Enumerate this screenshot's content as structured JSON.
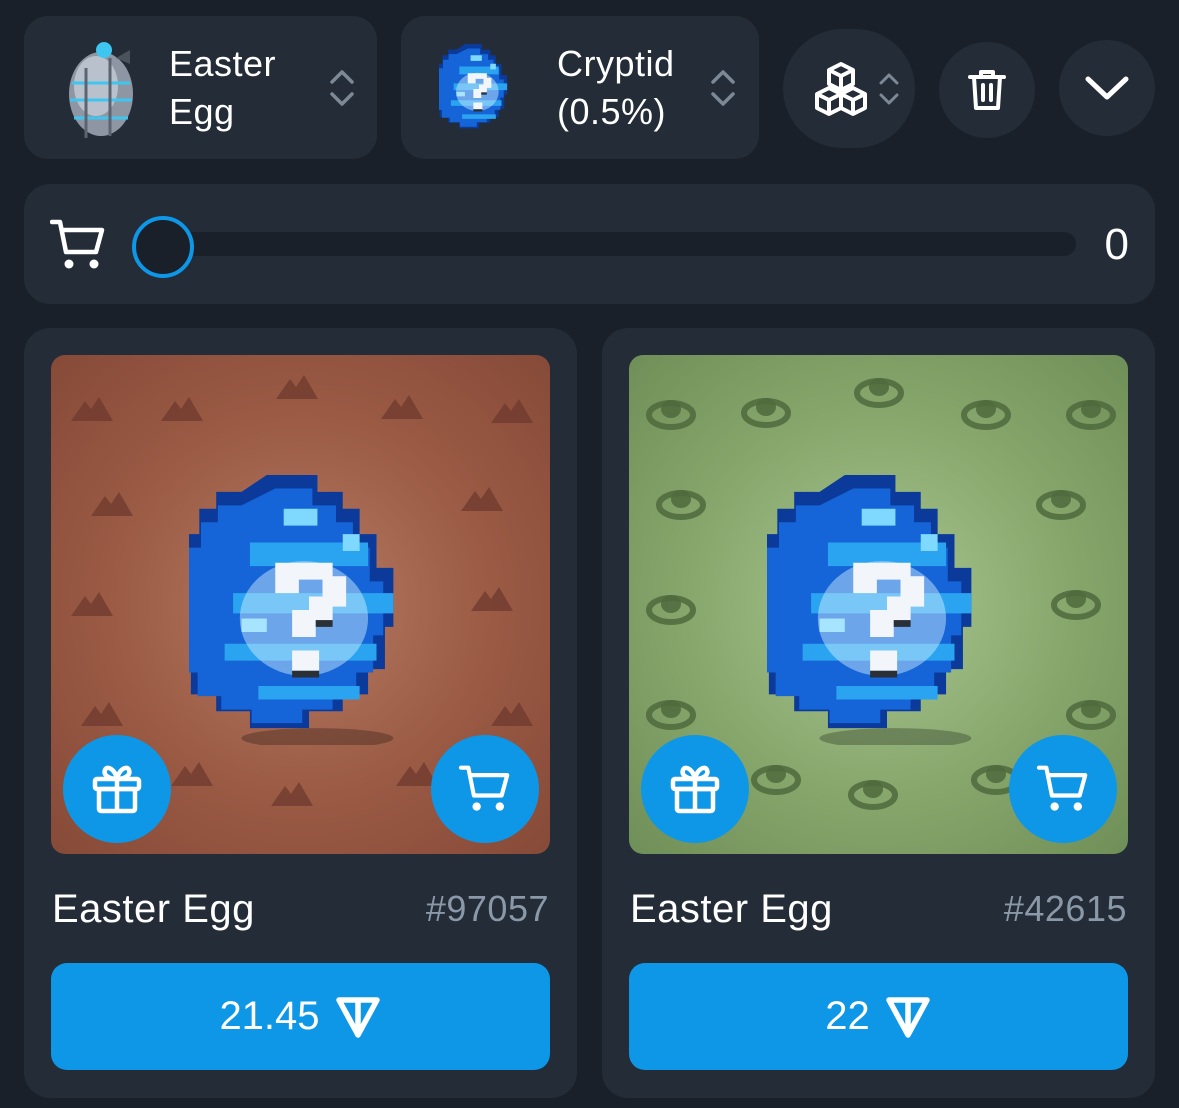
{
  "filters": {
    "collection": {
      "label": "Easter Egg",
      "line1": "Easter",
      "line2": "Egg",
      "icon": "easter-egg-thumbnail"
    },
    "model": {
      "label": "Cryptid (0.5%)",
      "line1": "Cryptid",
      "line2": "(0.5%)",
      "icon": "cryptid-egg-thumbnail"
    },
    "sort_icon": "cubes-icon",
    "trash_icon": "trash-icon",
    "expand_icon": "chevron-down-icon"
  },
  "cart": {
    "icon": "cart-icon",
    "count": "0",
    "slider_value": 0
  },
  "items": [
    {
      "title": "Easter Egg",
      "number": "#97057",
      "price": "21.45",
      "currency_icon": "ton-icon",
      "background_color": "#9a5a44",
      "pattern": "mountains",
      "gift_icon": "gift-icon",
      "cart_icon": "cart-icon"
    },
    {
      "title": "Easter Egg",
      "number": "#42615",
      "price": "22",
      "currency_icon": "ton-icon",
      "background_color": "#7f9e67",
      "pattern": "sombreros",
      "gift_icon": "gift-icon",
      "cart_icon": "cart-icon"
    }
  ],
  "colors": {
    "accent": "#0e97e6",
    "panel": "#232c37",
    "background": "#19202a",
    "muted_text": "#8a98a8"
  }
}
